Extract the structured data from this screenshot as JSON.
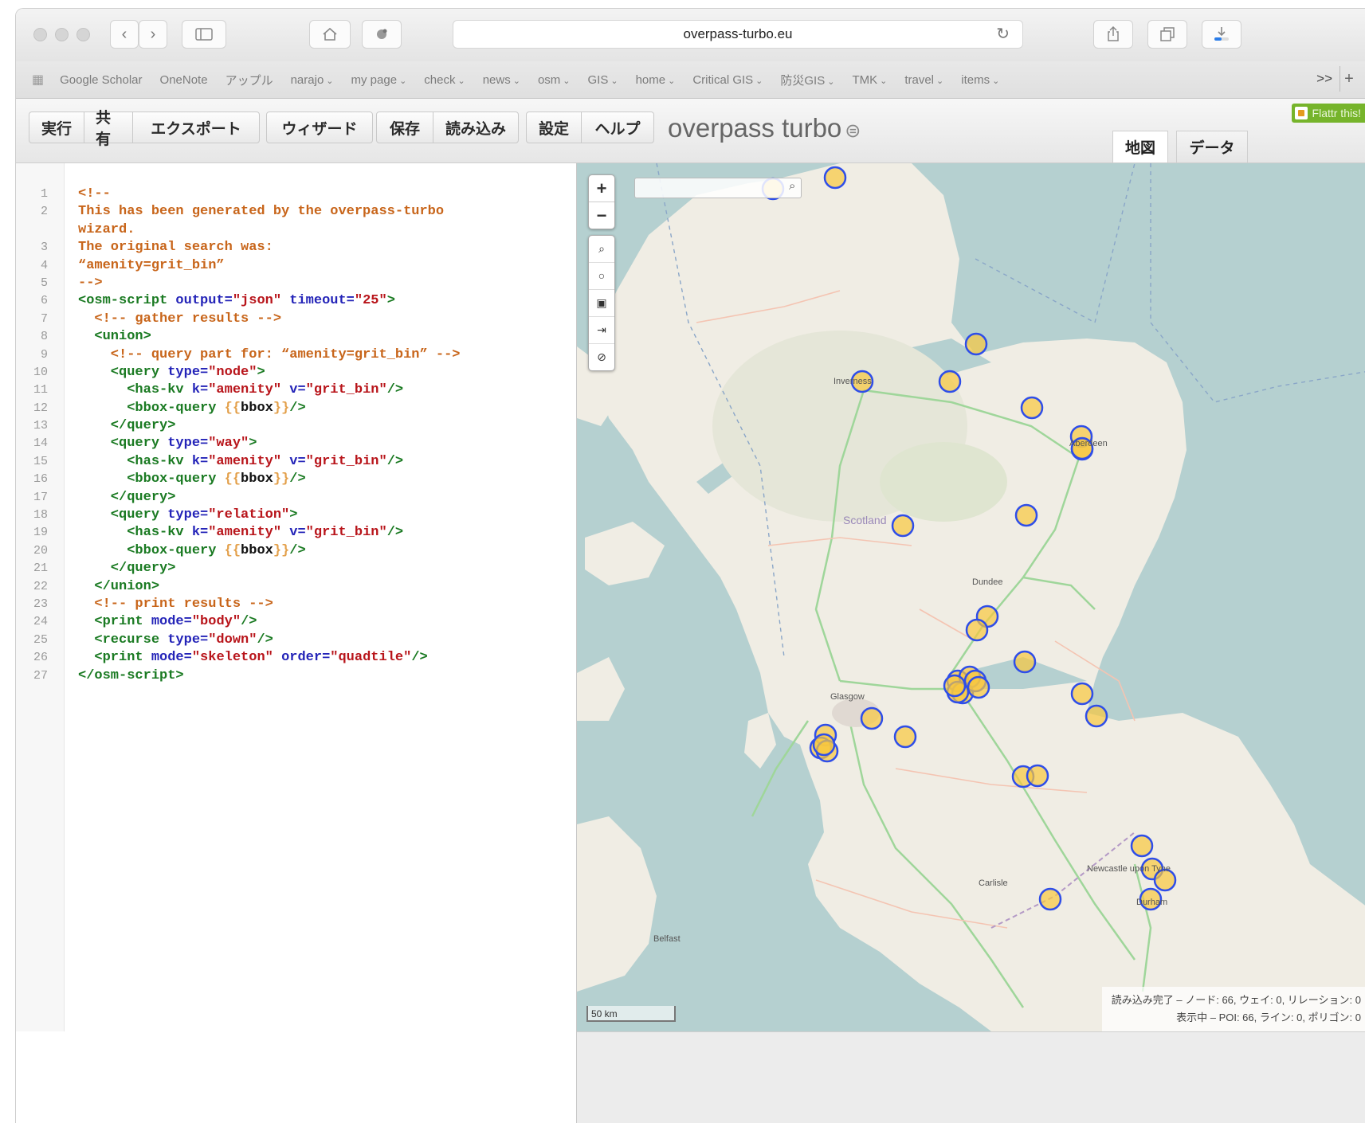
{
  "browser": {
    "url": "overpass-turbo.eu",
    "bookmarks": [
      {
        "label": "Google Scholar",
        "menu": false
      },
      {
        "label": "OneNote",
        "menu": false
      },
      {
        "label": "アップル",
        "menu": false
      },
      {
        "label": "narajo",
        "menu": true
      },
      {
        "label": "my page",
        "menu": true
      },
      {
        "label": "check",
        "menu": true
      },
      {
        "label": "news",
        "menu": true
      },
      {
        "label": "osm",
        "menu": true
      },
      {
        "label": "GIS",
        "menu": true
      },
      {
        "label": "home",
        "menu": true
      },
      {
        "label": "Critical GIS",
        "menu": true
      },
      {
        "label": "防災GIS",
        "menu": true
      },
      {
        "label": "TMK",
        "menu": true
      },
      {
        "label": "travel",
        "menu": true
      },
      {
        "label": "items",
        "menu": true
      }
    ],
    "bookmarks_more": ">>",
    "bookmarks_add": "+"
  },
  "toolbar": {
    "groups": [
      [
        "実行",
        "共有",
        "エクスポート"
      ],
      [
        "ウィザード"
      ],
      [
        "保存",
        "読み込み"
      ],
      [
        "設定",
        "ヘルプ"
      ]
    ],
    "logo": "overpass turbo",
    "flattr": "Flattr this!",
    "view_tabs": [
      "地図",
      "データ"
    ]
  },
  "editor": {
    "lines": [
      [
        [
          "c",
          "<!--"
        ]
      ],
      [
        [
          "c",
          "This has been generated by the overpass-turbo"
        ]
      ],
      [
        [
          "c",
          "wizard."
        ]
      ],
      [
        [
          "c",
          "The original search was:"
        ]
      ],
      [
        [
          "c",
          "“amenity=grit_bin”"
        ]
      ],
      [
        [
          "c",
          "-->"
        ]
      ],
      [
        [
          "t",
          "<osm-script "
        ],
        [
          "a",
          "output="
        ],
        [
          "v",
          "\"json\" "
        ],
        [
          "a",
          "timeout="
        ],
        [
          "v",
          "\"25\""
        ],
        [
          "t",
          ">"
        ]
      ],
      [
        [
          "c",
          "  <!-- gather results -->"
        ]
      ],
      [
        [
          "t",
          "  <union>"
        ]
      ],
      [
        [
          "c",
          "    <!-- query part for: “amenity=grit_bin” -->"
        ]
      ],
      [
        [
          "t",
          "    <query "
        ],
        [
          "a",
          "type="
        ],
        [
          "v",
          "\"node\""
        ],
        [
          "t",
          ">"
        ]
      ],
      [
        [
          "t",
          "      <has-kv "
        ],
        [
          "a",
          "k="
        ],
        [
          "v",
          "\"amenity\" "
        ],
        [
          "a",
          "v="
        ],
        [
          "v",
          "\"grit_bin\""
        ],
        [
          "t",
          "/>"
        ]
      ],
      [
        [
          "t",
          "      <bbox-query "
        ],
        [
          "b",
          "{{"
        ],
        [
          "p",
          "bbox"
        ],
        [
          "b",
          "}}"
        ],
        [
          "t",
          "/>"
        ]
      ],
      [
        [
          "t",
          "    </query>"
        ]
      ],
      [
        [
          "t",
          "    <query "
        ],
        [
          "a",
          "type="
        ],
        [
          "v",
          "\"way\""
        ],
        [
          "t",
          ">"
        ]
      ],
      [
        [
          "t",
          "      <has-kv "
        ],
        [
          "a",
          "k="
        ],
        [
          "v",
          "\"amenity\" "
        ],
        [
          "a",
          "v="
        ],
        [
          "v",
          "\"grit_bin\""
        ],
        [
          "t",
          "/>"
        ]
      ],
      [
        [
          "t",
          "      <bbox-query "
        ],
        [
          "b",
          "{{"
        ],
        [
          "p",
          "bbox"
        ],
        [
          "b",
          "}}"
        ],
        [
          "t",
          "/>"
        ]
      ],
      [
        [
          "t",
          "    </query>"
        ]
      ],
      [
        [
          "t",
          "    <query "
        ],
        [
          "a",
          "type="
        ],
        [
          "v",
          "\"relation\""
        ],
        [
          "t",
          ">"
        ]
      ],
      [
        [
          "t",
          "      <has-kv "
        ],
        [
          "a",
          "k="
        ],
        [
          "v",
          "\"amenity\" "
        ],
        [
          "a",
          "v="
        ],
        [
          "v",
          "\"grit_bin\""
        ],
        [
          "t",
          "/>"
        ]
      ],
      [
        [
          "t",
          "      <bbox-query "
        ],
        [
          "b",
          "{{"
        ],
        [
          "p",
          "bbox"
        ],
        [
          "b",
          "}}"
        ],
        [
          "t",
          "/>"
        ]
      ],
      [
        [
          "t",
          "    </query>"
        ]
      ],
      [
        [
          "t",
          "  </union>"
        ]
      ],
      [
        [
          "c",
          "  <!-- print results -->"
        ]
      ],
      [
        [
          "t",
          "  <print "
        ],
        [
          "a",
          "mode="
        ],
        [
          "v",
          "\"body\""
        ],
        [
          "t",
          "/>"
        ]
      ],
      [
        [
          "t",
          "  <recurse "
        ],
        [
          "a",
          "type="
        ],
        [
          "v",
          "\"down\""
        ],
        [
          "t",
          "/>"
        ]
      ],
      [
        [
          "t",
          "  <print "
        ],
        [
          "a",
          "mode="
        ],
        [
          "v",
          "\"skeleton\" "
        ],
        [
          "a",
          "order="
        ],
        [
          "v",
          "\"quadtile\""
        ],
        [
          "t",
          "/>"
        ]
      ],
      [
        [
          "t",
          "</osm-script>"
        ]
      ]
    ],
    "line_numbers": [
      "1",
      "2",
      "",
      "3",
      "4",
      "5",
      "6",
      "7",
      "8",
      "9",
      "10",
      "11",
      "12",
      "13",
      "14",
      "15",
      "16",
      "17",
      "18",
      "19",
      "20",
      "21",
      "22",
      "23",
      "24",
      "25",
      "26",
      "27"
    ]
  },
  "map": {
    "zoom_in": "+",
    "zoom_out": "−",
    "places": [
      {
        "name": "Inverness",
        "cls": ""
      },
      {
        "name": "Aberdeen",
        "cls": ""
      },
      {
        "name": "Scotland",
        "cls": "big"
      },
      {
        "name": "Dundee",
        "cls": ""
      },
      {
        "name": "Glasgow",
        "cls": ""
      },
      {
        "name": "Newcastle upon Tyne",
        "cls": ""
      },
      {
        "name": "Carlisle",
        "cls": ""
      },
      {
        "name": "Durham",
        "cls": ""
      },
      {
        "name": "Belfast",
        "cls": ""
      }
    ],
    "scale": "50 km",
    "status_line1": "読み込み完了 – ノード: 66, ウェイ: 0, リレーション: 0",
    "status_line2": "表示中 – POI: 66, ライン: 0, ポリゴン: 0",
    "colors": {
      "sea": "#b5d0d0",
      "land": "#f0ede4",
      "marker_fill": "#f8c73e",
      "marker_stroke": "#2f4ee8"
    }
  }
}
